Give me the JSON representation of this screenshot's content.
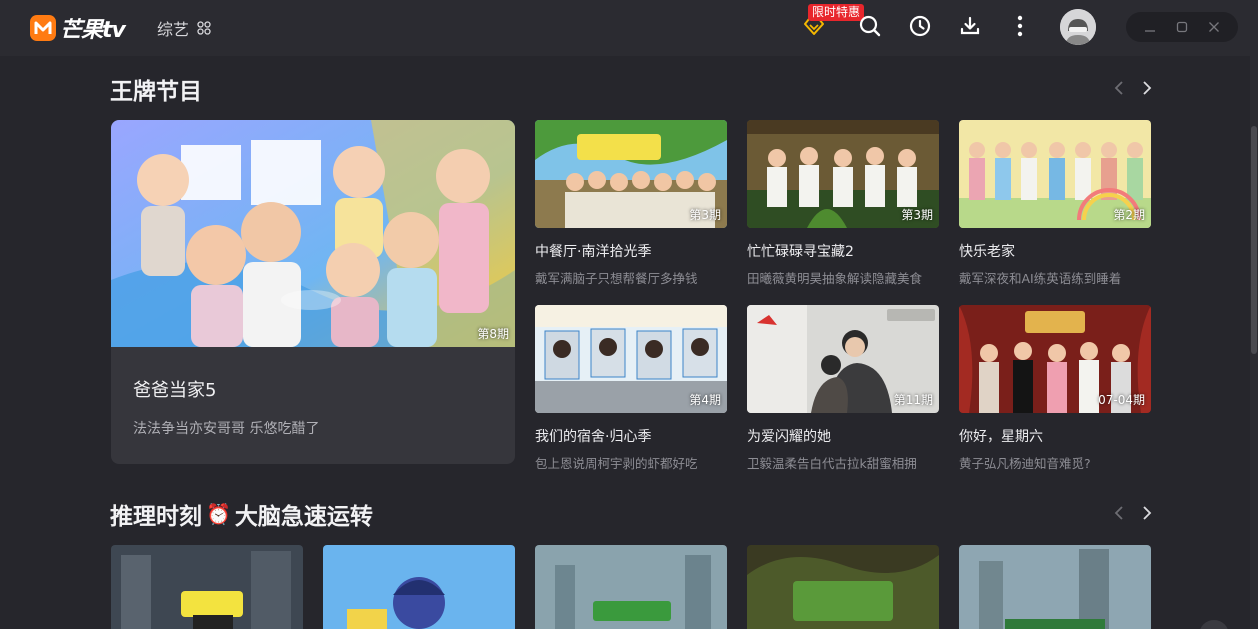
{
  "app": {
    "logo_text": "芒果tv"
  },
  "nav": {
    "category_label": "综艺"
  },
  "promo": {
    "badge": "限时特惠"
  },
  "sections": [
    {
      "title": "王牌节目"
    },
    {
      "title": "推理时刻",
      "emoji": "⏰",
      "title_suffix": "大脑急速运转"
    }
  ],
  "hero": {
    "title": "爸爸当家5",
    "subtitle": "法法争当亦安哥哥 乐悠吃醋了",
    "episode": "第8期"
  },
  "cards": [
    {
      "title": "中餐厅·南洋拾光季",
      "subtitle": "戴军满脑子只想帮餐厅多挣钱",
      "episode": "第3期"
    },
    {
      "title": "忙忙碌碌寻宝藏2",
      "subtitle": "田曦薇黄明昊抽象解读隐藏美食",
      "episode": "第3期"
    },
    {
      "title": "快乐老家",
      "subtitle": "戴军深夜和AI练英语练到睡着",
      "episode": "第2期"
    },
    {
      "title": "我们的宿舍·归心季",
      "subtitle": "包上恩说周柯宇剥的虾都好吃",
      "episode": "第4期"
    },
    {
      "title": "为爱闪耀的她",
      "subtitle": "卫毅温柔告白代古拉k甜蜜相拥",
      "episode": "第11期"
    },
    {
      "title": "你好，星期六",
      "subtitle": "黄子弘凡杨迪知音难觅?",
      "episode": "07-04期"
    }
  ],
  "colors": {
    "accent": "#ff7b12",
    "badge": "#e8262c",
    "background": "#26262c"
  }
}
